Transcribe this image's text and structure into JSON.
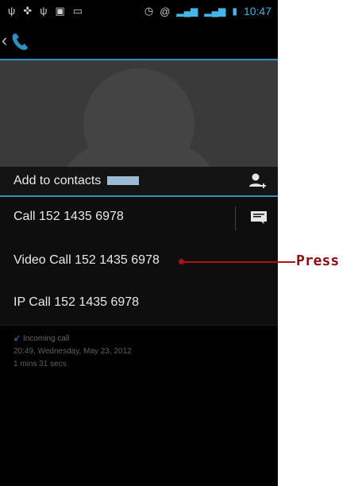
{
  "status_bar": {
    "time": "10:47"
  },
  "contact": {
    "add_to_contacts_label": "Add to contacts",
    "call_label": "Call 152 1435 6978",
    "video_call_label": "Video Call 152 1435 6978",
    "ip_call_label": "IP Call 152 1435 6978"
  },
  "call_log": {
    "type": "Incoming call",
    "datetime": "20:49, Wednesday, May 23, 2012",
    "duration": "1 mins 31 secs"
  },
  "annotation": {
    "text": "Press",
    "color": "#8b0d0d"
  },
  "colors": {
    "accent": "#2c91bf",
    "background": "#000000"
  }
}
